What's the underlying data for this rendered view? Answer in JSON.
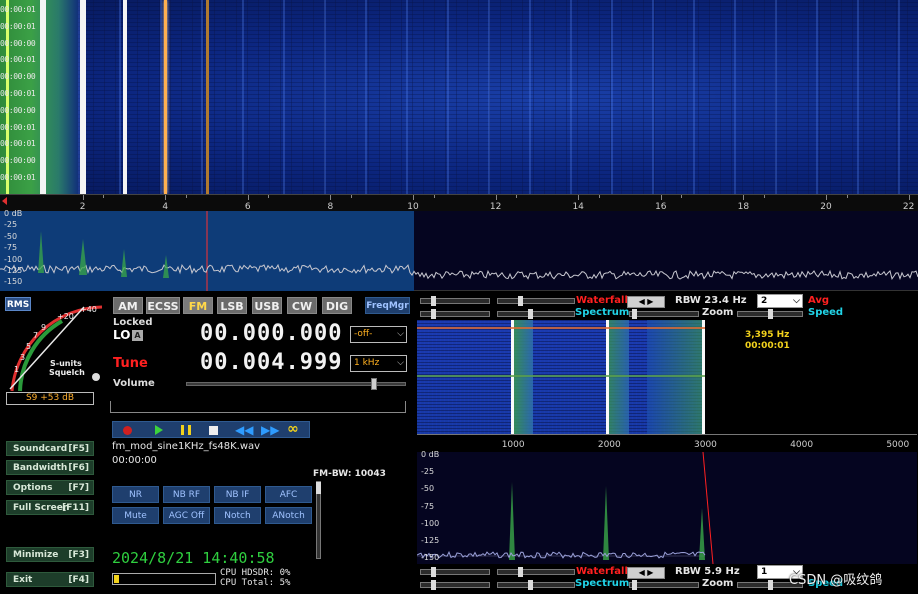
{
  "waterfall": {
    "timestamps": [
      "00:00:01",
      "00:00:01",
      "00:00:00",
      "00:00:01",
      "00:00:00",
      "00:00:01",
      "00:00:00",
      "00:00:01",
      "00:00:01",
      "00:00:00",
      "00:00:01"
    ],
    "axis_ticks": [
      "2",
      "4",
      "6",
      "8",
      "10",
      "12",
      "14",
      "16",
      "18",
      "20",
      "22"
    ],
    "db_labels": [
      "0 dB",
      "-25",
      "-50",
      "-75",
      "-100",
      "-125",
      "-150"
    ]
  },
  "smeter": {
    "rms_label": "RMS",
    "scale": [
      "+40",
      "+20",
      "9",
      "7",
      "5",
      "3",
      "1"
    ],
    "s_units_label": "S-units",
    "squelch_label": "Squelch",
    "reading": "S9 +53 dB"
  },
  "modes": [
    "AM",
    "ECSS",
    "FM",
    "LSB",
    "USB",
    "CW",
    "DIG"
  ],
  "active_mode": "FM",
  "freqmgr_label": "FreqMgr",
  "lo": {
    "locked_label": "Locked",
    "lo_label": "LO",
    "a_badge": "A",
    "frequency": "00.000.000",
    "dropdown": "-off-"
  },
  "tune": {
    "label": "Tune",
    "frequency": "00.004.999",
    "step": "1 kHz"
  },
  "volume_label": "Volume",
  "volume_level": 0.86,
  "side_buttons": [
    {
      "label": "Soundcard",
      "key": "[F5]"
    },
    {
      "label": "Bandwidth",
      "key": "[F6]"
    },
    {
      "label": "Options",
      "key": "[F7]"
    },
    {
      "label": "Full Screen",
      "key": "[F11]"
    },
    {
      "label": "Minimize",
      "key": "[F3]"
    },
    {
      "label": "Exit",
      "key": "[F4]"
    }
  ],
  "player": {
    "filename": "fm_mod_sine1KHz_fs48K.wav",
    "position": "00:00:00"
  },
  "fm_bw": "FM-BW: 10043",
  "dsp_buttons": [
    "NR",
    "NB RF",
    "NB IF",
    "AFC",
    "Mute",
    "AGC Off",
    "Notch",
    "ANotch"
  ],
  "datetime": "2024/8/21 14:40:58",
  "cpu": {
    "hdsdr": "CPU HDSDR:  0%",
    "total": "CPU Total:  5%"
  },
  "audio_top": {
    "waterfall_label": "Waterfall",
    "spectrum_label": "Spectrum",
    "rbw": "RBW 23.4 Hz",
    "avg_combo": "2",
    "avg_label": "Avg",
    "zoom_label": "Zoom",
    "speed_label": "Speed",
    "cursor_freq": "3,395 Hz",
    "cursor_time": "00:00:01"
  },
  "audio_axis": [
    "1000",
    "2000",
    "3000",
    "4000",
    "5000"
  ],
  "audio_db_labels": [
    "0 dB",
    "-25",
    "-50",
    "-75",
    "-100",
    "-125",
    "-150"
  ],
  "audio_bottom": {
    "waterfall_label": "Waterfall",
    "spectrum_label": "Spectrum",
    "rbw": "RBW  5.9 Hz",
    "avg_combo": "1",
    "zoom_label": "Zoom",
    "speed_label": "Speed"
  },
  "watermark": "CSDN @吸纹鸽",
  "colors": {
    "waterfall_blue": "#1739a5",
    "signal_green": "#3ba046",
    "accent_red": "#ff2020",
    "lcd_text": "#f2f2f2",
    "datetime_green": "#2fcf3f"
  }
}
